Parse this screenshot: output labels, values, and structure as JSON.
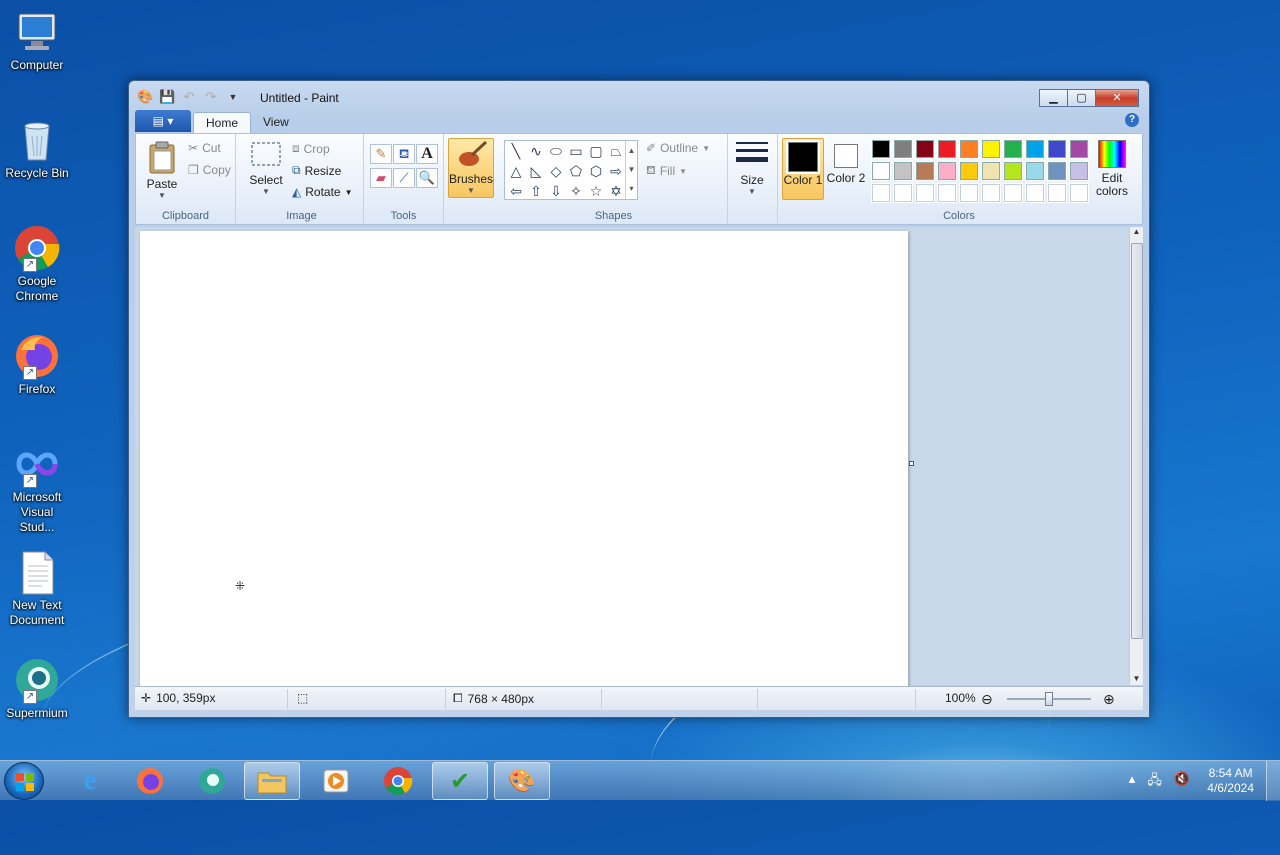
{
  "desktop": {
    "icons": [
      {
        "label": "Computer"
      },
      {
        "label": "Recycle Bin"
      },
      {
        "label": "Google Chrome"
      },
      {
        "label": "Firefox"
      },
      {
        "label": "Microsoft Visual Stud..."
      },
      {
        "label": "New Text Document"
      },
      {
        "label": "Supermium"
      }
    ]
  },
  "window": {
    "title": "Untitled - Paint",
    "tabs": {
      "home": "Home",
      "view": "View"
    },
    "clipboard": {
      "paste": "Paste",
      "cut": "Cut",
      "copy": "Copy",
      "label": "Clipboard"
    },
    "image": {
      "select": "Select",
      "crop": "Crop",
      "resize": "Resize",
      "rotate": "Rotate",
      "label": "Image"
    },
    "tools": {
      "label": "Tools",
      "text_tool": "A"
    },
    "brushes": {
      "label": "Brushes"
    },
    "shapes": {
      "outline": "Outline",
      "fill": "Fill",
      "label": "Shapes"
    },
    "size": {
      "label": "Size"
    },
    "colors": {
      "color1": "Color 1",
      "color2": "Color 2",
      "edit": "Edit colors",
      "label": "Colors",
      "color1_value": "#000000",
      "color2_value": "#ffffff",
      "palette": [
        "#000000",
        "#7f7f7f",
        "#880015",
        "#ed1c24",
        "#ff7f27",
        "#fff200",
        "#22b14c",
        "#00a2e8",
        "#3f48cc",
        "#a349a4",
        "#ffffff",
        "#c3c3c3",
        "#b97a57",
        "#ffaec9",
        "#ffc90e",
        "#efe4b0",
        "#b5e61d",
        "#99d9ea",
        "#7092be",
        "#c8bfe7"
      ]
    },
    "status": {
      "cursor": "100, 359px",
      "size": "768 × 480px",
      "zoom": "100%"
    }
  },
  "taskbar": {
    "time": "8:54 AM",
    "date": "4/6/2024"
  }
}
